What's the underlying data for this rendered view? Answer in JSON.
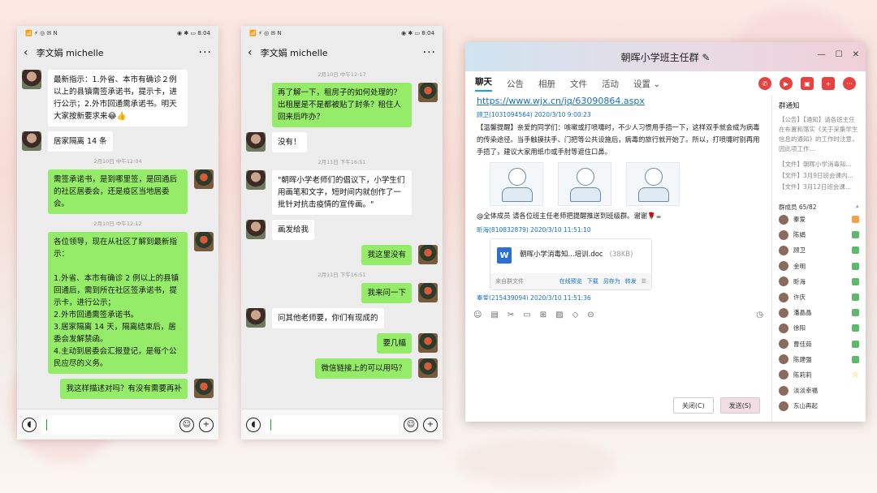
{
  "phone1": {
    "status_left": "📶 ⚡ ◎ ✉ N",
    "status_right": "◉ ✱ ▭ 8:04",
    "contact": "李文娟 michelle",
    "messages": [
      {
        "side": "left",
        "text": "最新指示：1.外省、本市有确诊２例以上的县镇需签承诺书，提示卡，进行公示；2.外市回通需承诺书。明天大家按新要求来😂👍"
      },
      {
        "side": "left",
        "text": "居家隔离 14 条"
      },
      {
        "side": "time",
        "text": "2月10日 中午12:04"
      },
      {
        "side": "right",
        "text": "需签承诺书，是到哪里签，是回通后的社区居委会，还是疫区当地居委会。"
      },
      {
        "side": "time",
        "text": "2月10日 中午12:12"
      },
      {
        "side": "right",
        "text": "各位领导，现在从社区了解到最新指示：\n\n1.外省、本市有确诊 2 例以上的县镇回通后，需到所在社区签承诺书，提示卡，进行公示；\n2.外市回通需签承诺书。\n3.居家隔离 14 天，隔离结束后，居委会发解禁函。\n4.主动到居委会汇报登记，是每个公民应尽的义务。"
      },
      {
        "side": "right",
        "text": "我这样描述对吗？有没有需要再补"
      }
    ]
  },
  "phone2": {
    "status_left": "📶 ⚡ ◎ ✉ N",
    "status_right": "◉ ✱ ▭ 8:04",
    "contact": "李文娟 michelle",
    "messages": [
      {
        "side": "time",
        "text": "2月10日 中午12:17"
      },
      {
        "side": "right",
        "text": "再了解一下，租房子的如何处理的？出租屋是不是都被贴了封条？租住人回来后咋办？"
      },
      {
        "side": "left",
        "text": "没有！"
      },
      {
        "side": "time",
        "text": "2月11日 下午16:51"
      },
      {
        "side": "left",
        "text": "\"朝晖小学老师们的倡议下，小学生们用画笔和文字，短时间内就创作了一批针对抗击疫情的宣传画。\""
      },
      {
        "side": "left",
        "text": "画发给我"
      },
      {
        "side": "right",
        "text": "我这里没有"
      },
      {
        "side": "time",
        "text": "2月11日 下午16:51"
      },
      {
        "side": "right",
        "text": "我来问一下"
      },
      {
        "side": "left",
        "text": "问其他老师要，你们有现成的"
      },
      {
        "side": "right",
        "text": "要几幅"
      },
      {
        "side": "right",
        "text": "微信链接上的可以用吗？"
      }
    ]
  },
  "qq": {
    "title": "朝晖小学班主任群 ✎",
    "tabs": [
      "聊天",
      "公告",
      "相册",
      "文件",
      "活动",
      "设置 ⌄"
    ],
    "url": "https://www.wjx.cn/jq/63090864.aspx",
    "msg1_sender": "顾卫(1031094564)  2020/3/10 9:00:23",
    "msg1_text": "【温馨提醒】亲爱的同学们：咳嗽或打喷嚏时，不少人习惯用手捂一下，这样双手就会成为病毒的传染途径。当手触摸扶手、门把等公共设施后，病毒的旅行就开始了。所以，打喷嚏时别再用手捂了，建议大家用纸巾或手肘等遮住口鼻。",
    "msg1_tail": "@全体成员 请各位班主任老师把提醒推送到班级群。谢谢🌹☕",
    "msg2_sender": "昕海(810832879)  2020/3/10 11:51:10",
    "file_name": "朝晖小学消毒知...培训.doc",
    "file_size": "(38KB)",
    "file_from": "来自群文件",
    "file_actions": [
      "在线预览",
      "下载",
      "另存为",
      "转发"
    ],
    "msg3_sender": "秦爱(215439094)  2020/3/10 11:51:36",
    "close_label": "关闭(C)",
    "send_label": "发送(S)",
    "notice_title": "群通知",
    "notice_text": "【公告】【通知】请各班主任在布置和落实《关于采集学生信息的通知》的工作时注意，因此项工作...",
    "files": [
      "【文件】朝晖小学消毒知...",
      "【文件】3月9日班会课内...",
      "【文件】3月12日班会课..."
    ],
    "members_title": "群成员 65/82",
    "members": [
      "秦爱",
      "陈娟",
      "顾卫",
      "金明",
      "昕海",
      "许庆",
      "潘晶晶",
      "徐阳",
      "曹佳茹",
      "陈建强",
      "陈莉莉",
      "淡淡幸福",
      "东山再起"
    ]
  }
}
